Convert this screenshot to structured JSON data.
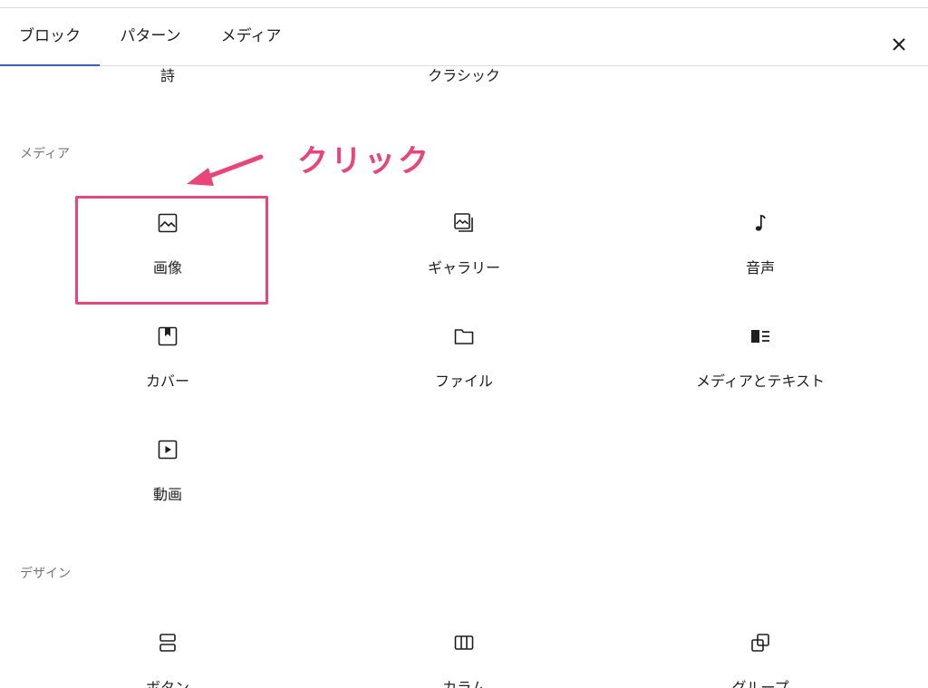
{
  "tabs": [
    {
      "label": "ブロック",
      "active": true
    },
    {
      "label": "パターン",
      "active": false
    },
    {
      "label": "メディア",
      "active": false
    }
  ],
  "close_icon": "close-icon",
  "top_row": {
    "items": [
      "詩",
      "クラシック"
    ]
  },
  "sections": {
    "media": {
      "title": "メディア",
      "items": [
        {
          "label": "画像",
          "icon": "image-icon"
        },
        {
          "label": "ギャラリー",
          "icon": "gallery-icon"
        },
        {
          "label": "音声",
          "icon": "audio-icon"
        },
        {
          "label": "カバー",
          "icon": "cover-icon"
        },
        {
          "label": "ファイル",
          "icon": "file-icon"
        },
        {
          "label": "メディアとテキスト",
          "icon": "media-text-icon"
        },
        {
          "label": "動画",
          "icon": "video-icon"
        }
      ]
    },
    "design": {
      "title": "デザイン",
      "items": [
        {
          "label": "ボタン",
          "icon": "buttons-icon"
        },
        {
          "label": "カラム",
          "icon": "columns-icon"
        },
        {
          "label": "グループ",
          "icon": "group-icon"
        }
      ]
    }
  },
  "annotation": {
    "text": "クリック",
    "color": "#e8457a"
  },
  "accent_color": "#3858e9"
}
